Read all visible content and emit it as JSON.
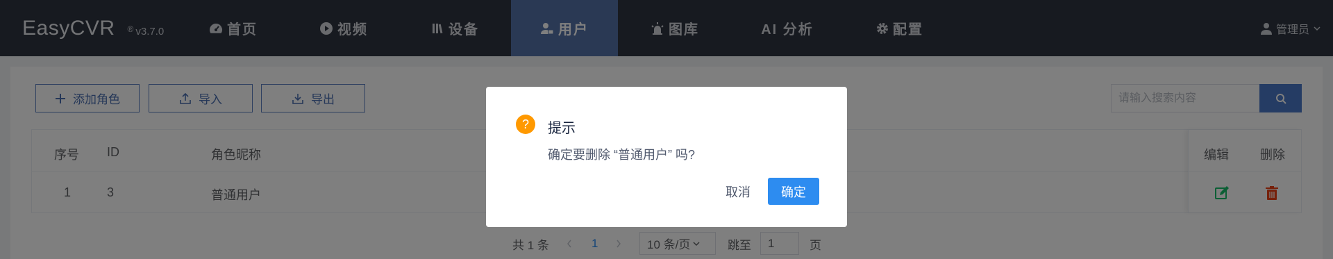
{
  "app": {
    "name": "EasyCVR",
    "reg_mark": "®",
    "version": "v3.7.0"
  },
  "nav": {
    "home": "首页",
    "video": "视频",
    "devices": "设备",
    "users": "用户",
    "gallery": "图库",
    "ai": "AI 分析",
    "config": "配置",
    "active": "users"
  },
  "user_menu": {
    "name": "管理员"
  },
  "toolbar": {
    "add_role": "添加角色",
    "import": "导入",
    "export": "导出",
    "search_placeholder": "请输入搜索内容"
  },
  "table": {
    "headers": {
      "index": "序号",
      "id": "ID",
      "nickname": "角色昵称",
      "edit": "编辑",
      "delete": "删除"
    },
    "rows": [
      {
        "index": "1",
        "id": "3",
        "nickname": "普通用户"
      }
    ]
  },
  "pagination": {
    "total": "共 1 条",
    "current_page": "1",
    "page_size": "10 条/页",
    "jump_label": "跳至",
    "jump_value": "1",
    "page_suffix": "页"
  },
  "dialog": {
    "title": "提示",
    "icon": "?",
    "message": "确定要删除 “普通用户” 吗?",
    "cancel": "取消",
    "ok": "确定"
  },
  "colors": {
    "header_bg": "#2f3441",
    "nav_active": "#5572a8",
    "primary": "#2d8cf0",
    "warning": "#ff9900",
    "edit": "#19be6b",
    "delete": "#ed4014"
  }
}
